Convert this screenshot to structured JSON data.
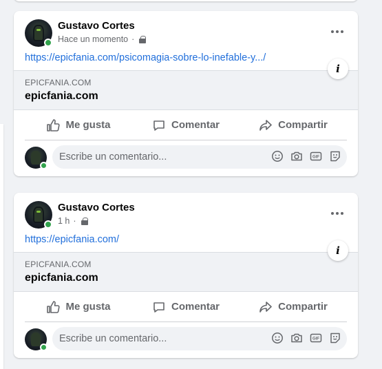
{
  "posts": [
    {
      "author": "Gustavo Cortes",
      "time": "Hace un momento",
      "separator": "·",
      "link": "https://epicfania.com/psicomagia-sobre-lo-inefable-y.../",
      "preview": {
        "domain": "EPICFANIA.COM",
        "title": "epicfania.com"
      },
      "info_label": "i",
      "actions": {
        "like": "Me gusta",
        "comment": "Comentar",
        "share": "Compartir"
      },
      "comment_placeholder": "Escribe un comentario..."
    },
    {
      "author": "Gustavo Cortes",
      "time": "1 h",
      "separator": "·",
      "link": "https://epicfania.com/",
      "preview": {
        "domain": "EPICFANIA.COM",
        "title": "epicfania.com"
      },
      "info_label": "i",
      "actions": {
        "like": "Me gusta",
        "comment": "Comentar",
        "share": "Compartir"
      },
      "comment_placeholder": "Escribe un comentario..."
    }
  ],
  "colors": {
    "link": "#216fdb",
    "online": "#31a24c",
    "secondary_text": "#65676b",
    "background": "#f0f2f5"
  },
  "icons": {
    "like": "thumbs-up-icon",
    "comment": "speech-bubble-icon",
    "share": "share-arrow-icon",
    "emoji": "smiley-icon",
    "camera": "camera-icon",
    "gif": "gif-icon",
    "sticker": "sticker-icon"
  }
}
